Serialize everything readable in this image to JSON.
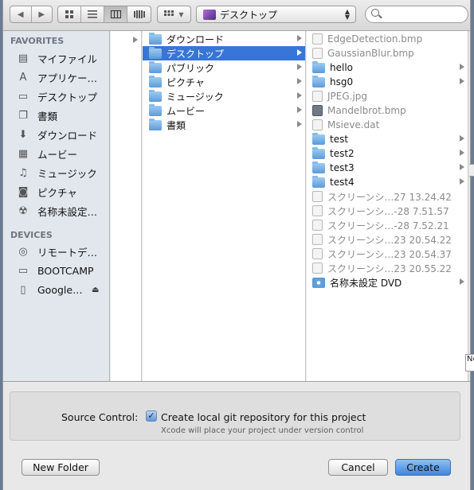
{
  "toolbar": {
    "nav": {
      "back_icon": "chevron-left-icon",
      "forward_icon": "chevron-right-icon"
    },
    "views": [
      {
        "name": "icon-view",
        "active": false
      },
      {
        "name": "list-view",
        "active": false
      },
      {
        "name": "column-view",
        "active": true
      },
      {
        "name": "coverflow-view",
        "active": false
      }
    ],
    "arrange_icon": "grid-icon",
    "location": "デスクトップ",
    "search": {
      "placeholder": ""
    }
  },
  "sidebar": {
    "favorites_header": "FAVORITES",
    "favorites": [
      {
        "label": "マイファイル",
        "icon": "my-files-icon"
      },
      {
        "label": "アプリケー…",
        "icon": "applications-icon"
      },
      {
        "label": "デスクトップ",
        "icon": "desktop-icon"
      },
      {
        "label": "書類",
        "icon": "documents-icon"
      },
      {
        "label": "ダウンロード",
        "icon": "downloads-icon"
      },
      {
        "label": "ムービー",
        "icon": "movies-icon"
      },
      {
        "label": "ミュージック",
        "icon": "music-icon"
      },
      {
        "label": "ピクチャ",
        "icon": "pictures-icon"
      },
      {
        "label": "名称未設定…",
        "icon": "dvd-icon"
      }
    ],
    "devices_header": "DEVICES",
    "devices": [
      {
        "label": "リモートデ…",
        "icon": "remote-disc-icon"
      },
      {
        "label": "BOOTCAMP",
        "icon": "disk-icon"
      },
      {
        "label": "Google…",
        "icon": "disk-icon"
      }
    ]
  },
  "columns": {
    "col1": [
      {
        "label": "",
        "has_children": true
      }
    ],
    "col2": [
      {
        "label": "ダウンロード",
        "has_children": true
      },
      {
        "label": "デスクトップ",
        "has_children": true,
        "selected": true
      },
      {
        "label": "パブリック",
        "has_children": true
      },
      {
        "label": "ピクチャ",
        "has_children": true
      },
      {
        "label": "ミュージック",
        "has_children": true
      },
      {
        "label": "ムービー",
        "has_children": true
      },
      {
        "label": "書類",
        "has_children": true
      }
    ],
    "col3": [
      {
        "label": "EdgeDetection.bmp",
        "kind": "file",
        "dim": true
      },
      {
        "label": "GaussianBlur.bmp",
        "kind": "file",
        "dim": true
      },
      {
        "label": "hello",
        "kind": "folder",
        "has_children": true
      },
      {
        "label": "hsg0",
        "kind": "folder",
        "has_children": true
      },
      {
        "label": "JPEG.jpg",
        "kind": "file",
        "dim": true
      },
      {
        "label": "Mandelbrot.bmp",
        "kind": "file-dark",
        "dim": true
      },
      {
        "label": "Msieve.dat",
        "kind": "file",
        "dim": true
      },
      {
        "label": "test",
        "kind": "folder",
        "has_children": true
      },
      {
        "label": "test2",
        "kind": "folder",
        "has_children": true
      },
      {
        "label": "test3",
        "kind": "folder",
        "has_children": true
      },
      {
        "label": "test4",
        "kind": "folder",
        "has_children": true
      },
      {
        "label": "スクリーンシ…27 13.24.42",
        "kind": "file",
        "dim": true
      },
      {
        "label": "スクリーンシ…-28 7.51.57",
        "kind": "file",
        "dim": true
      },
      {
        "label": "スクリーンシ…-28 7.52.21",
        "kind": "file",
        "dim": true
      },
      {
        "label": "スクリーンシ…23 20.54.22",
        "kind": "file",
        "dim": true
      },
      {
        "label": "スクリーンシ…23 20.54.37",
        "kind": "file",
        "dim": true
      },
      {
        "label": "スクリーンシ…23 20.55.22",
        "kind": "file",
        "dim": true
      },
      {
        "label": "名称未設定 DVD",
        "kind": "dvd",
        "has_children": true
      }
    ]
  },
  "options": {
    "source_control_label": "Source Control:",
    "checkbox_checked": true,
    "checkbox_label": "Create local git repository for this project",
    "hint": "Xcode will place your project under version control"
  },
  "buttons": {
    "new_folder": "New Folder",
    "cancel": "Cancel",
    "create": "Create"
  },
  "edge_text": "Ne"
}
